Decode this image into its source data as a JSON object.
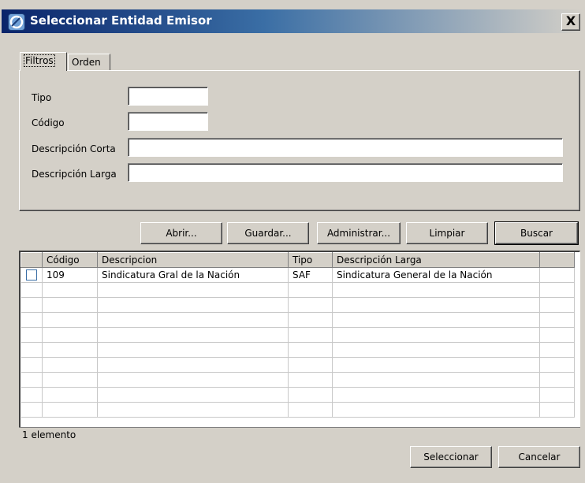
{
  "window": {
    "title": "Seleccionar Entidad Emisor",
    "close_label": "X"
  },
  "tabs": [
    {
      "label": "Filtros",
      "active": true
    },
    {
      "label": "Orden",
      "active": false
    }
  ],
  "filters": {
    "tipo": {
      "label": "Tipo",
      "value": ""
    },
    "codigo": {
      "label": "Código",
      "value": ""
    },
    "desc_corta": {
      "label": "Descripción Corta",
      "value": ""
    },
    "desc_larga": {
      "label": "Descripción Larga",
      "value": ""
    }
  },
  "actions": {
    "abrir": "Abrir...",
    "guardar": "Guardar...",
    "administrar": "Administrar...",
    "limpiar": "Limpiar",
    "buscar": "Buscar"
  },
  "table": {
    "columns": [
      "",
      "Código",
      "Descripcion",
      "Tipo",
      "Descripción Larga",
      ""
    ],
    "rows": [
      {
        "checked": false,
        "codigo": "109",
        "descripcion": "Sindicatura Gral de la Nación",
        "tipo": "SAF",
        "desc_larga": "Sindicatura General de la Nación"
      }
    ]
  },
  "status": "1 elemento",
  "footer": {
    "seleccionar": "Seleccionar",
    "cancelar": "Cancelar"
  },
  "colors": {
    "titlebar_start": "#0a246a",
    "face": "#d4d0c8"
  }
}
